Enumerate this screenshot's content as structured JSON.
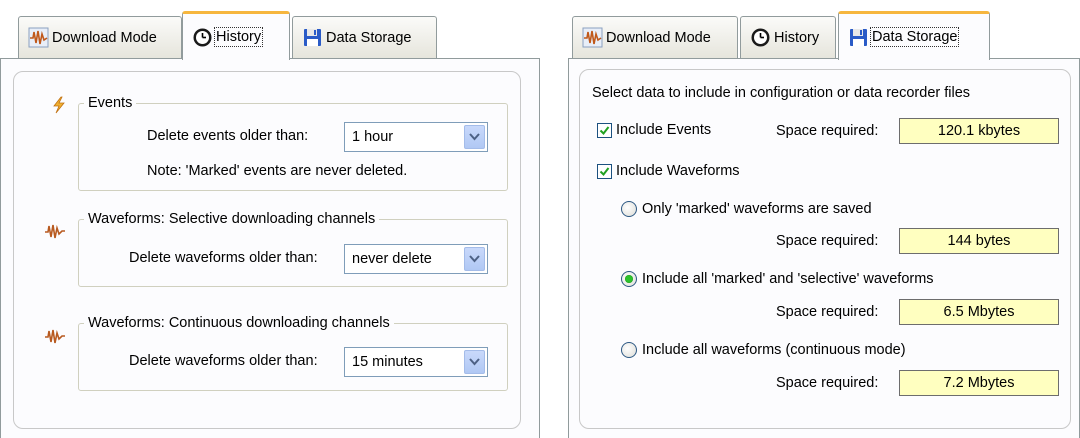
{
  "left": {
    "tabs": [
      {
        "label": "Download Mode",
        "icon": "waveform-icon"
      },
      {
        "label": "History",
        "icon": "clock-icon"
      },
      {
        "label": "Data Storage",
        "icon": "floppy-disk-icon"
      }
    ],
    "active_tab": "History",
    "events": {
      "title": "Events",
      "delete_label": "Delete events older than:",
      "delete_value": "1 hour",
      "note": "Note:  'Marked' events are never deleted."
    },
    "selective": {
      "title": "Waveforms:  Selective downloading channels",
      "delete_label": "Delete waveforms older than:",
      "delete_value": "never delete"
    },
    "continuous": {
      "title": "Waveforms:  Continuous downloading channels",
      "delete_label": "Delete waveforms older than:",
      "delete_value": "15 minutes"
    }
  },
  "right": {
    "tabs": [
      {
        "label": "Download Mode",
        "icon": "waveform-icon"
      },
      {
        "label": "History",
        "icon": "clock-icon"
      },
      {
        "label": "Data Storage",
        "icon": "floppy-disk-icon"
      }
    ],
    "active_tab": "Data Storage",
    "intro": "Select data to include in configuration or data recorder files",
    "include_events": {
      "label": "Include Events",
      "checked": true
    },
    "events_space": {
      "label": "Space required:",
      "value": "120.1 kbytes"
    },
    "include_waveforms": {
      "label": "Include Waveforms",
      "checked": true
    },
    "options": [
      {
        "label": "Only 'marked' waveforms are saved",
        "selected": false,
        "space_label": "Space required:",
        "space_value": "144 bytes"
      },
      {
        "label": "Include all 'marked' and 'selective' waveforms",
        "selected": true,
        "space_label": "Space required:",
        "space_value": "6.5 Mbytes"
      },
      {
        "label": "Include all waveforms (continuous mode)",
        "selected": false,
        "space_label": "Space required:",
        "space_value": "7.2 Mbytes"
      }
    ]
  },
  "colors": {
    "tab_highlight": "#f6b63e",
    "field_yellow": "#ffffc0",
    "radio_selected": "#2cc22c",
    "border": "#919b9c"
  }
}
